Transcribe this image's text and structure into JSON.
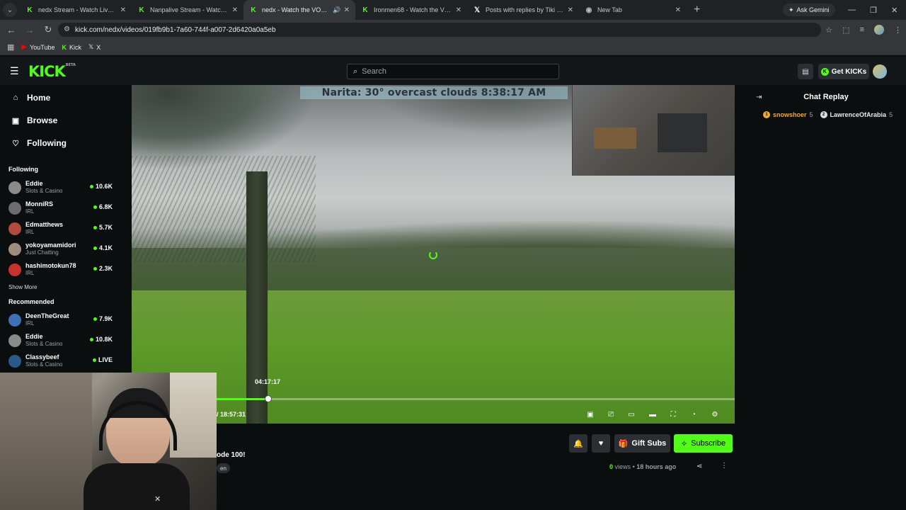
{
  "browser": {
    "tabs": [
      {
        "title": "nedx Stream - Watch Live on Kick",
        "active": false,
        "audio": false
      },
      {
        "title": "Nanpalive Stream - Watch Live on Kick",
        "active": false,
        "audio": false
      },
      {
        "title": "nedx - Watch the VOD on Kick",
        "active": true,
        "audio": true
      },
      {
        "title": "Ironmen68 - Watch the VOD on Kick",
        "active": false,
        "audio": false
      },
      {
        "title": "Posts with replies by Tiki NedX",
        "active": false,
        "audio": false
      },
      {
        "title": "New Tab",
        "active": false,
        "audio": false
      }
    ],
    "gemini_label": "Ask Gemini",
    "url": "kick.com/nedx/videos/019fb9b1-7a60-744f-a007-2d6420a0a5eb",
    "bookmarks": [
      {
        "label": "YouTube",
        "icon": "youtube-icon"
      },
      {
        "label": "Kick",
        "icon": "kick-icon"
      },
      {
        "label": "X",
        "icon": "x-icon"
      }
    ]
  },
  "kick": {
    "logo": "KICK",
    "logo_badge": "BETA",
    "search_placeholder": "Search",
    "get_kicks_label": "Get KICKs",
    "nav": [
      {
        "label": "Home",
        "icon": "home-icon"
      },
      {
        "label": "Browse",
        "icon": "browse-icon"
      },
      {
        "label": "Following",
        "icon": "heart-icon"
      }
    ],
    "following_header": "Following",
    "following": [
      {
        "name": "Eddie",
        "category": "Slots & Casino",
        "viewers": "10.6K"
      },
      {
        "name": "MonniRS",
        "category": "IRL",
        "viewers": "6.8K"
      },
      {
        "name": "Edmatthews",
        "category": "IRL",
        "viewers": "5.7K"
      },
      {
        "name": "yokoyamamidori",
        "category": "Just Chatting",
        "viewers": "4.1K"
      },
      {
        "name": "hashimotokun78",
        "category": "IRL",
        "viewers": "2.3K"
      }
    ],
    "show_more": "Show More",
    "recommended_header": "Recommended",
    "recommended": [
      {
        "name": "DeenTheGreat",
        "category": "IRL",
        "viewers": "7.9K"
      },
      {
        "name": "Eddie",
        "category": "Slots & Casino",
        "viewers": "10.8K"
      },
      {
        "name": "Classybeef",
        "category": "Slots & Casino",
        "viewers": "LIVE"
      }
    ],
    "player": {
      "overlay_text": "Narita: 30°     overcast clouds 8:38:17 AM",
      "hover_time": "04:17:17",
      "timecode": "/ 18:57:31",
      "progress": 0.1
    },
    "below": {
      "title_fragment": "ode 100!",
      "language": "en",
      "gift_subs_label": "Gift Subs",
      "subscribe_label": "Subscribe",
      "views_count": "0",
      "views_label": "views",
      "separator": "•",
      "age": "18 hours ago"
    },
    "chat": {
      "title": "Chat Replay",
      "messages": [
        {
          "user": "snowshoer",
          "badge_text": "5",
          "color": "#f2a93b"
        },
        {
          "user": "LawrenceOfArabia",
          "badge_text": "5",
          "color": "#e8eaed"
        }
      ]
    }
  }
}
